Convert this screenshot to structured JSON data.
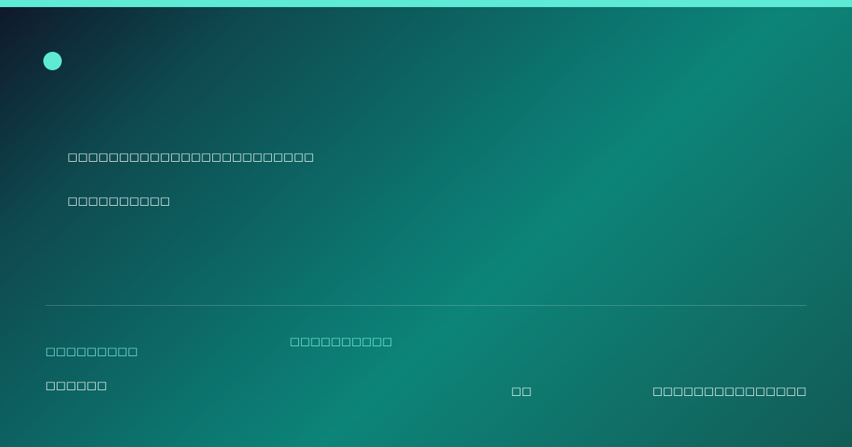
{
  "theme": {
    "accent": "#5eead4"
  },
  "hero": {
    "headline": "□□□□□□□□□□□□□□□□□□□□□□□□",
    "subline": "□□□□□□□□□□"
  },
  "footer": {
    "left_primary": "□□□□□□□□□",
    "left_secondary": "□□□□□□",
    "center": "□□□□□□□□□□",
    "mid_right": "□□",
    "right": "□□□□□□□□□□□□□□□"
  }
}
